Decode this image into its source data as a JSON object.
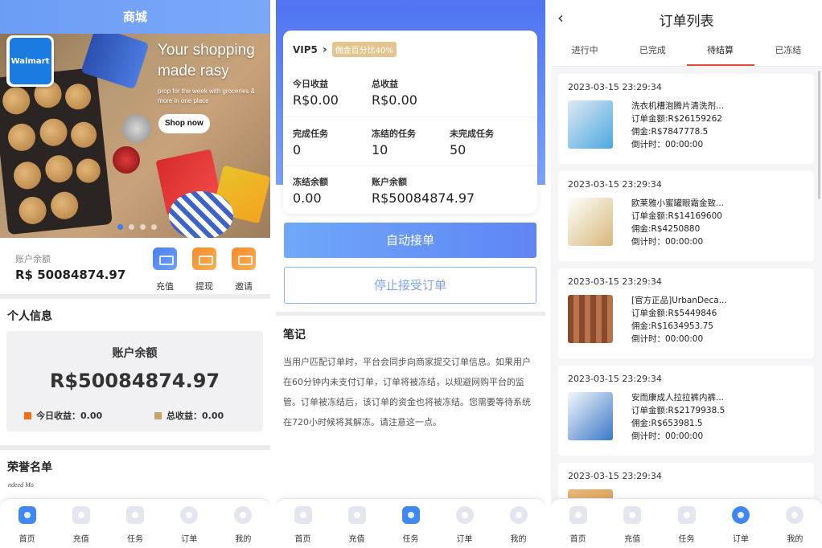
{
  "phone1": {
    "header_title": "商城",
    "banner": {
      "logo_text": "Walmart",
      "title_line1": "Your shopping",
      "title_line2": "made rasy",
      "subtitle": "prop for the week with groceries & more in one place",
      "cta": "Shop now"
    },
    "balance_label": "账户余额",
    "balance_value": "R$ 50084874.97",
    "quick_actions": [
      {
        "label": "充值",
        "icon": "wallet-icon",
        "color": "#4b7ef0"
      },
      {
        "label": "提现",
        "icon": "card-icon",
        "color": "#f58a2c"
      },
      {
        "label": "邀请",
        "icon": "invite-icon",
        "color": "#f58a2c"
      }
    ],
    "personal_info_title": "个人信息",
    "info_card": {
      "title": "账户余额",
      "amount": "R$50084874.97",
      "today_label": "今日收益：0.00",
      "total_label": "总收益：0.00",
      "today_color": "#f2700e",
      "total_color": "#c9a36a"
    },
    "honor_title": "荣誉名单",
    "honor_logo_text": "ndeed Mo"
  },
  "phone2": {
    "vip_name": "VIP5",
    "vip_badge": "佣金百分比40%",
    "stats_row1": [
      {
        "label": "今日收益",
        "value": "R$0.00"
      },
      {
        "label": "总收益",
        "value": "R$0.00"
      }
    ],
    "stats_row2": [
      {
        "label": "完成任务",
        "value": "0"
      },
      {
        "label": "冻结的任务",
        "value": "10"
      },
      {
        "label": "未完成任务",
        "value": "50"
      }
    ],
    "stats_row3": [
      {
        "label": "冻结余额",
        "value": "0.00"
      },
      {
        "label": "账户余额",
        "value": "R$50084874.97"
      }
    ],
    "auto_button": "自动接单",
    "stop_button": "停止接受订单",
    "notes_title": "笔记",
    "notes_text": "当用户匹配订单时，平台会同步向商家提交订单信息。如果用户在60分钟内未支付订单，订单将被冻结，以规避网购平台的监管。订单被冻结后，该订单的资金也将被冻结。您需要等待系统在720小时候将其解冻。请注意这一点。"
  },
  "phone3": {
    "title": "订单列表",
    "tabs": [
      "进行中",
      "已完成",
      "待结算",
      "已冻结"
    ],
    "active_tab": 2,
    "orders": [
      {
        "time": "2023-03-15 23:29:34",
        "name": "洗衣机槽泡腾片清洗剂...",
        "amount": "订单金额:R$26159262",
        "commission": "佣金:R$7847778.5",
        "countdown": "倒计时：00:00:00",
        "thumb_color": "#4aa8e0"
      },
      {
        "time": "2023-03-15 23:29:34",
        "name": "欧莱雅小蜜罐眼霜金致...",
        "amount": "订单金额:R$14169600",
        "commission": "佣金:R$4250880",
        "countdown": "倒计时：00:00:00",
        "thumb_color": "#d7b77a"
      },
      {
        "time": "2023-03-15 23:29:34",
        "name": "[官方正品]UrbanDeca...",
        "amount": "订单金额:R$5449846",
        "commission": "佣金:R$1634953.75",
        "countdown": "倒计时：00:00:00",
        "thumb_color": "#8a4a2e"
      },
      {
        "time": "2023-03-15 23:29:34",
        "name": "安而康成人拉拉裤内裤...",
        "amount": "订单金额:R$2179938.5",
        "commission": "佣金:R$653981.5",
        "countdown": "倒计时：00:00:00",
        "thumb_color": "#3a78c8"
      },
      {
        "time": "2023-03-15 23:29:34",
        "name": "",
        "amount": "",
        "commission": "",
        "countdown": "",
        "thumb_color": "#d89a55"
      }
    ]
  },
  "navs": {
    "p1": [
      {
        "label": "首页",
        "icon": "home-icon",
        "active": true
      },
      {
        "label": "充值",
        "icon": "recharge-icon",
        "active": false
      },
      {
        "label": "任务",
        "icon": "task-icon",
        "active": false
      },
      {
        "label": "订单",
        "icon": "order-icon",
        "active": false
      },
      {
        "label": "我的",
        "icon": "profile-icon",
        "active": false
      }
    ],
    "p2": [
      {
        "label": "首页",
        "icon": "home-icon",
        "active": false
      },
      {
        "label": "充值",
        "icon": "recharge-icon",
        "active": false
      },
      {
        "label": "任务",
        "icon": "task-icon",
        "active": true
      },
      {
        "label": "订单",
        "icon": "order-icon",
        "active": false
      },
      {
        "label": "我的",
        "icon": "profile-icon",
        "active": false
      }
    ],
    "p3": [
      {
        "label": "首页",
        "icon": "home-icon",
        "active": false
      },
      {
        "label": "充值",
        "icon": "recharge-icon",
        "active": false
      },
      {
        "label": "任务",
        "icon": "task-icon",
        "active": false
      },
      {
        "label": "订单",
        "icon": "order-icon",
        "active": true
      },
      {
        "label": "我的",
        "icon": "profile-icon",
        "active": false
      }
    ]
  },
  "colors": {
    "primary_blue": "#5f85f4",
    "active_tab_underline": "#e64a3b"
  }
}
